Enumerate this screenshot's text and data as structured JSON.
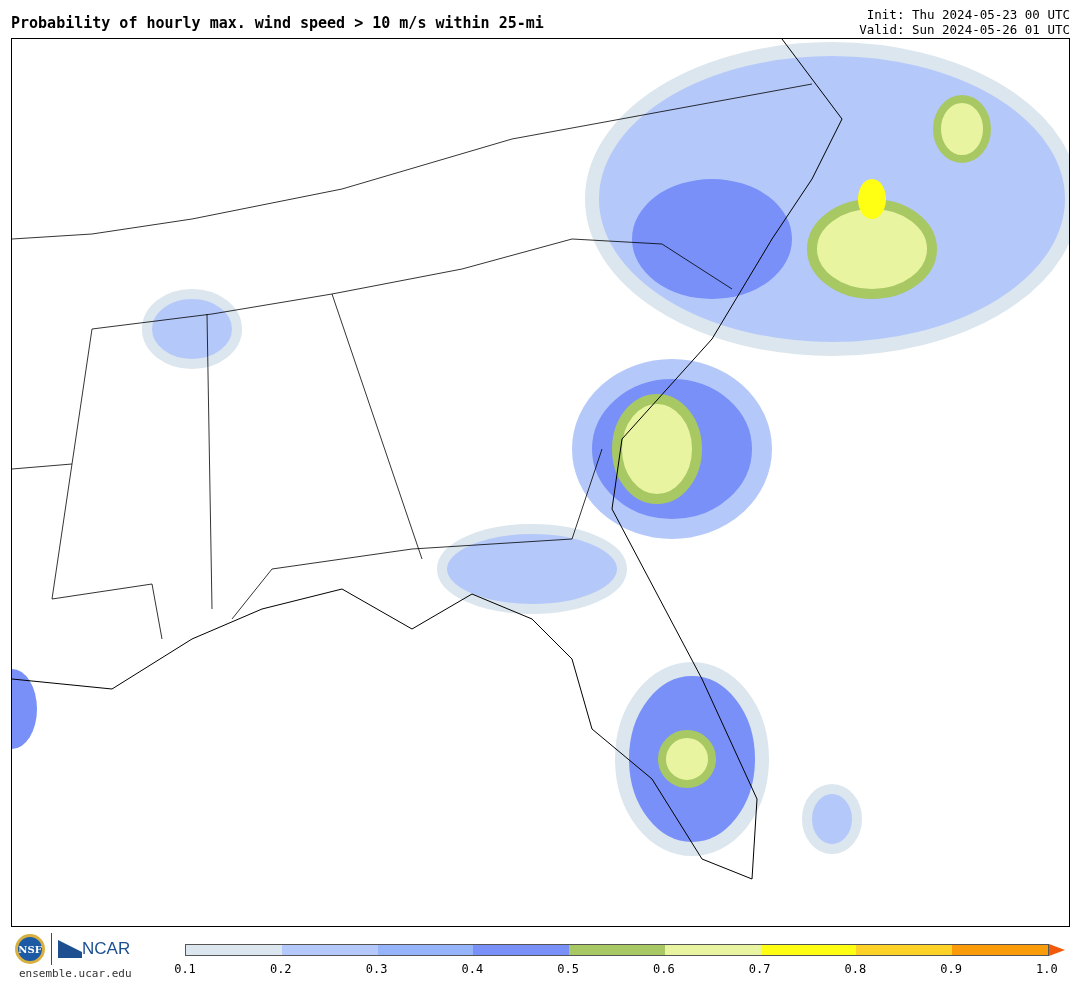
{
  "title": "Probability of hourly max. wind speed > 10 m/s within 25-mi",
  "init": "Init: Thu 2024-05-23 00 UTC",
  "valid": "Valid: Sun 2024-05-26 01 UTC",
  "logos": {
    "nsf": "NSF",
    "ncar": "NCAR",
    "url": "ensemble.ucar.edu"
  },
  "colorbar": {
    "bins": [
      {
        "color": "#dce6ee"
      },
      {
        "color": "#b4c8fa"
      },
      {
        "color": "#96b4fa"
      },
      {
        "color": "#7890f8"
      },
      {
        "color": "#a8c864"
      },
      {
        "color": "#e8f4a0"
      },
      {
        "color": "#ffff14"
      },
      {
        "color": "#ffd228"
      },
      {
        "color": "#fa9b0a"
      }
    ],
    "extend": {
      "color": "#f05a0a"
    },
    "ticks": [
      "0.1",
      "0.2",
      "0.3",
      "0.4",
      "0.5",
      "0.6",
      "0.7",
      "0.8",
      "0.9",
      "1.0"
    ]
  }
}
